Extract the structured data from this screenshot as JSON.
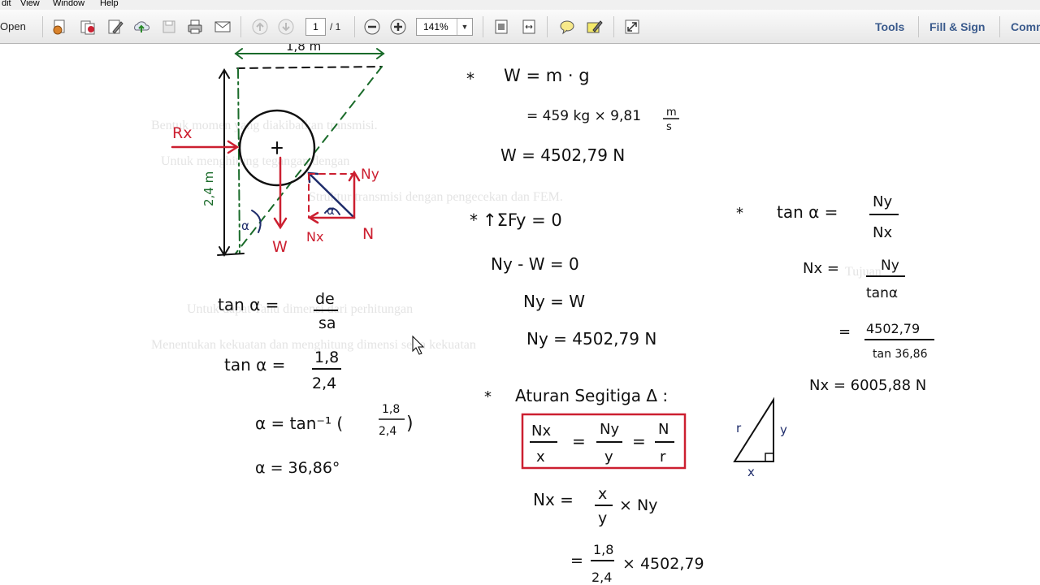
{
  "menu": {
    "items": [
      "dit",
      "View",
      "Window",
      "Help"
    ]
  },
  "toolbar": {
    "open_label": "Open",
    "page_current": "1",
    "page_total": "/ 1",
    "zoom": "141%",
    "tools_label": "Tools",
    "fill_sign_label": "Fill & Sign",
    "comment_label": "Comm"
  },
  "background_text": [
    "Bentuk momen yang diakibatkan transmisi.",
    "Untuk menghitung tegangan dengan",
    "Struktur transmisi dengan pengecekan dan FEM.",
    "Tujuan",
    "Untuk dapat Tahu dimensi dari perhitungan",
    "Menentukan kekuatan dan menghitung dimensi serta kekuatan"
  ],
  "diagram": {
    "width_label": "1,8 m",
    "height_label": "2,4 m",
    "rx_label": "Rx",
    "w_label": "W",
    "ny_label": "Ny",
    "nx_label": "Nx",
    "n_label": "N",
    "alpha": "α"
  },
  "left_eq": {
    "l1": "tan α  =",
    "l1_num": "de",
    "l1_den": "sa",
    "l2": "tan α  =",
    "l2_num": "1,8",
    "l2_den": "2,4",
    "l3": "α  =  tan⁻¹ (",
    "l3_num": "1,8",
    "l3_den": "2,4",
    "l3_close": ")",
    "l4": "α  =  36,86°"
  },
  "mid_eq": {
    "star1": "*",
    "w_def": "W = m · g",
    "w_sub": "= 459 kg × 9,81",
    "w_unit_num": "m",
    "w_unit_den": "s",
    "w_res": "W = 4502,79 N",
    "star2": "*",
    "sum": "↑ΣFy = 0",
    "e1": "Ny - W = 0",
    "e2": "Ny = W",
    "e3": "Ny = 4502,79 N",
    "star3": "*",
    "rule": "Aturan Segitiga Δ :",
    "box_nx": "Nx",
    "box_x": "x",
    "box_ny": "Ny",
    "box_y": "y",
    "box_n": "N",
    "box_r": "r",
    "eq1": "=",
    "eq2": "=",
    "nx_calc": "Nx  =",
    "nx_x": "x",
    "nx_y": "y",
    "nx_mul": "× Ny",
    "last_eq": "=",
    "last_num": "1,8",
    "last_den": "2,4",
    "last_mul": "× 4502,79",
    "tri_x": "x",
    "tri_y": "y",
    "tri_r": "r"
  },
  "right_eq": {
    "star": "*",
    "t1": "tan α  =",
    "t1_num": "Ny",
    "t1_den": "Nx",
    "t2": "Nx  =",
    "t2_num": "Ny",
    "t2_den": "tanα",
    "t3": "=",
    "t3_num": "4502,79",
    "t3_den": "tan 36,86",
    "t4": "Nx  =  6005,88 N"
  },
  "colors": {
    "ink": "#111111",
    "red": "#cc1f30",
    "green": "#1a6b2a",
    "navy": "#1f2d6b"
  }
}
